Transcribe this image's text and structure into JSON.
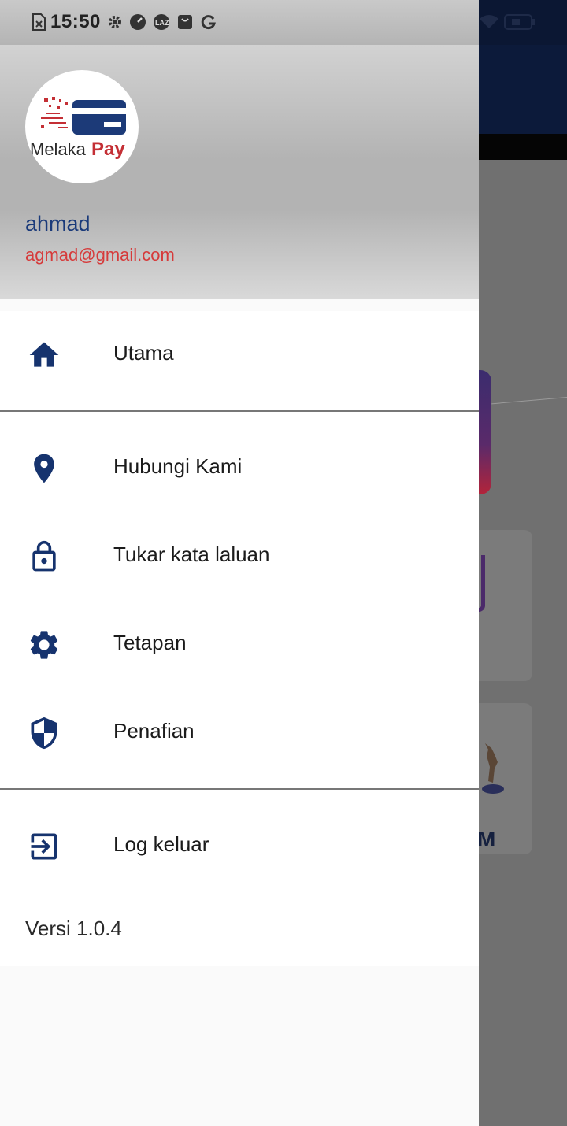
{
  "status_bar": {
    "time": "15:50"
  },
  "drawer": {
    "logo_text_1": "Melaka",
    "logo_text_2": "Pay",
    "user_name": "ahmad",
    "user_email": "agmad@gmail.com",
    "items": [
      {
        "label": "Utama",
        "icon": "home-icon"
      },
      {
        "label": "Hubungi Kami",
        "icon": "location-pin-icon"
      },
      {
        "label": "Tukar kata laluan",
        "icon": "lock-icon"
      },
      {
        "label": "Tetapan",
        "icon": "gear-icon"
      },
      {
        "label": "Penafian",
        "icon": "shield-icon"
      },
      {
        "label": "Log keluar",
        "icon": "logout-icon"
      }
    ],
    "version": "Versi 1.0.4"
  },
  "background": {
    "card_letter": "M"
  },
  "colors": {
    "primary": "#1a3a7a",
    "accent": "#d63a3a",
    "icon": "#16336e"
  }
}
